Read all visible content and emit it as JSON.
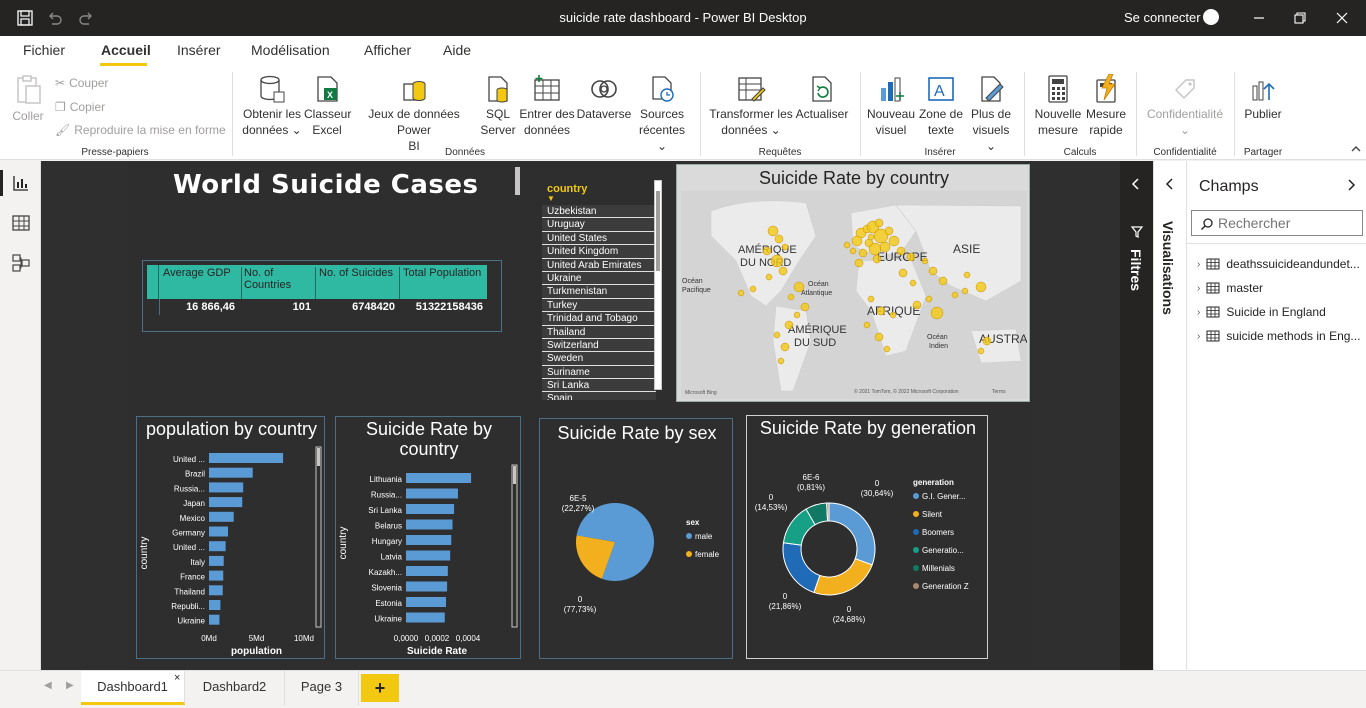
{
  "window": {
    "title": "suicide rate dashboard - Power BI Desktop",
    "signin": "Se connecter"
  },
  "menu": {
    "tabs": [
      "Fichier",
      "Accueil",
      "Insérer",
      "Modélisation",
      "Afficher",
      "Aide"
    ],
    "active": "Accueil"
  },
  "ribbon": {
    "clipboard": {
      "paste": "Coller",
      "cut": "Couper",
      "copy": "Copier",
      "format_painter": "Reproduire la mise en forme",
      "group": "Presse-papiers"
    },
    "data": {
      "get_data": [
        "Obtenir les",
        "données"
      ],
      "excel": [
        "Classeur",
        "Excel"
      ],
      "datasets": [
        "Jeux de données Power",
        "BI"
      ],
      "sql": [
        "SQL",
        "Server"
      ],
      "enter_data": [
        "Entrer des",
        "données"
      ],
      "dataverse": "Dataverse",
      "recent": [
        "Sources",
        "récentes"
      ],
      "group": "Données"
    },
    "queries": {
      "transform": [
        "Transformer les",
        "données"
      ],
      "refresh": "Actualiser",
      "group": "Requêtes"
    },
    "insert": {
      "visual": [
        "Nouveau",
        "visuel"
      ],
      "textbox": [
        "Zone de",
        "texte"
      ],
      "more": [
        "Plus de",
        "visuels"
      ],
      "group": "Insérer"
    },
    "calc": {
      "measure": [
        "Nouvelle",
        "mesure"
      ],
      "quick": [
        "Mesure",
        "rapide"
      ],
      "group": "Calculs"
    },
    "confid": {
      "label": "Confidentialité",
      "group": "Confidentialité"
    },
    "share": {
      "publish": "Publier",
      "group": "Partager"
    }
  },
  "report": {
    "title": "World Suicide Cases",
    "kpi_table": {
      "headers": [
        "Average GDP",
        "No. of Countries",
        "No. of Suicides",
        "Total Population"
      ],
      "values": [
        "16 866,46",
        "101",
        "6748420",
        "51322158436"
      ]
    },
    "slicer": {
      "title": "country",
      "items": [
        "Uzbekistan",
        "Uruguay",
        "United States",
        "United Kingdom",
        "United Arab Emirates",
        "Ukraine",
        "Turkmenistan",
        "Turkey",
        "Trinidad and Tobago",
        "Thailand",
        "Switzerland",
        "Sweden",
        "Suriname",
        "Sri Lanka",
        "Spain"
      ]
    },
    "map": {
      "title": "Suicide Rate by country",
      "labels": [
        "AMÉRIQUE",
        "DU NORD",
        "EUROPE",
        "ASIE",
        "Océan",
        "Pacifique",
        "Océan",
        "Atlantique",
        "AFRIQUE",
        "AMÉRIQUE",
        "DU SUD",
        "Océan",
        "Indien",
        "AUSTRA"
      ],
      "brand": "Microsoft Bing",
      "copyright": "© 2021 TomTom, © 2022 Microsoft Corporation",
      "terms": "Terms",
      "bubble_color": "#f2c811"
    }
  },
  "chart_data": [
    {
      "type": "bar",
      "orientation": "horizontal",
      "title": "population by country",
      "xlabel": "population",
      "ylabel": "country",
      "categories": [
        "United ...",
        "Brazil",
        "Russia...",
        "Japan",
        "Mexico",
        "Germany",
        "United ...",
        "Italy",
        "France",
        "Thailand",
        "Republi...",
        "Ukraine"
      ],
      "values": [
        7.8,
        4.6,
        3.6,
        3.5,
        2.6,
        2.0,
        1.75,
        1.55,
        1.5,
        1.45,
        1.2,
        1.1
      ],
      "xlim": [
        0,
        10
      ],
      "ticks": [
        "0Md",
        "5Md",
        "10Md"
      ],
      "color": "#5b9bd5"
    },
    {
      "type": "bar",
      "orientation": "horizontal",
      "title": "Suicide Rate by country",
      "xlabel": "Suicide Rate",
      "ylabel": "country",
      "categories": [
        "Lithuania",
        "Russia...",
        "Sri Lanka",
        "Belarus",
        "Hungary",
        "Latvia",
        "Kazakh...",
        "Slovenia",
        "Estonia",
        "Ukraine"
      ],
      "values": [
        0.00042,
        0.000335,
        0.00031,
        0.0003,
        0.000292,
        0.000285,
        0.00027,
        0.000265,
        0.000258,
        0.00025
      ],
      "xlim": [
        0,
        0.0004
      ],
      "ticks": [
        "0,0000",
        "0,0002",
        "0,0004"
      ],
      "color": "#5b9bd5"
    },
    {
      "type": "pie",
      "title": "Suicide Rate by sex",
      "legend_title": "sex",
      "slices": [
        {
          "name": "male",
          "value": 77.73,
          "label": "0",
          "pct": "(77,73%)",
          "color": "#5b9bd5"
        },
        {
          "name": "female",
          "value": 22.27,
          "label": "6E-5",
          "pct": "(22,27%)",
          "color": "#f2b01e"
        }
      ]
    },
    {
      "type": "pie",
      "donut": true,
      "title": "Suicide Rate by generation",
      "legend_title": "generation",
      "slices": [
        {
          "name": "G.I. Gener...",
          "value": 30.64,
          "label": "0",
          "pct": "(30,64%)",
          "color": "#5b9bd5"
        },
        {
          "name": "Silent",
          "value": 24.68,
          "label": "0",
          "pct": "(24,68%)",
          "color": "#f2b01e"
        },
        {
          "name": "Boomers",
          "value": 21.86,
          "label": "0",
          "pct": "(21,86%)",
          "color": "#1f6bb8"
        },
        {
          "name": "Generatio...",
          "value": 14.53,
          "label": "0",
          "pct": "(14,53%)",
          "color": "#16a085"
        },
        {
          "name": "Millenials",
          "value": 7.48,
          "label": "",
          "pct": "",
          "color": "#117864"
        },
        {
          "name": "Generation Z",
          "value": 0.81,
          "label": "6E-6",
          "pct": "(0,81%)",
          "color": "#a88a6e"
        }
      ]
    }
  ],
  "panes": {
    "filters": "Filtres",
    "visualizations": "Visualisations",
    "fields": "Champs",
    "search_placeholder": "Rechercher",
    "tables": [
      "deathssuicideandundet...",
      "master",
      "Suicide in England",
      "suicide methods in Eng..."
    ]
  },
  "pages": {
    "tabs": [
      "Dashboard1",
      "Dashbard2",
      "Page 3"
    ],
    "add": "+"
  }
}
